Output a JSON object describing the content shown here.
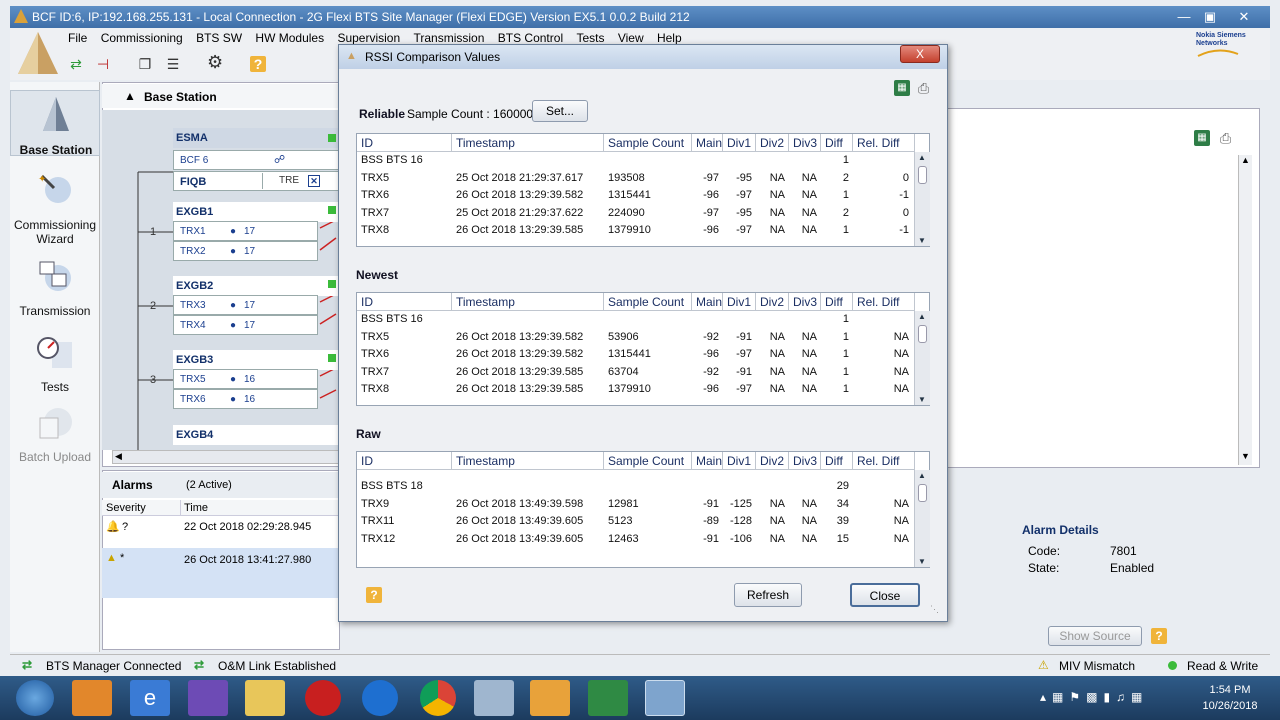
{
  "window": {
    "title": "BCF ID:6,  IP:192.168.255.131 - Local Connection - 2G Flexi BTS Site Manager (Flexi EDGE) Version EX5.1 0.0.2 Build 212"
  },
  "menu": [
    "File",
    "Commissioning",
    "BTS SW",
    "HW Modules",
    "Supervision",
    "Transmission",
    "BTS Control",
    "Tests",
    "View",
    "Help"
  ],
  "brand": {
    "line1": "Nokia Siemens",
    "line2": "Networks"
  },
  "nav": [
    {
      "label": "Base Station"
    },
    {
      "label": "Commissioning Wizard"
    },
    {
      "label": "Transmission"
    },
    {
      "label": "Tests"
    },
    {
      "label": "Batch Upload"
    }
  ],
  "base_station": {
    "header": "Base Station",
    "esma": "ESMA",
    "bcf": "BCF 6",
    "fiqb": "FIQB",
    "tre": "TRE",
    "groups": [
      {
        "name": "EXGB1",
        "num": "1",
        "trx": [
          {
            "name": "TRX1",
            "val": "17"
          },
          {
            "name": "TRX2",
            "val": "17"
          }
        ]
      },
      {
        "name": "EXGB2",
        "num": "2",
        "trx": [
          {
            "name": "TRX3",
            "val": "17"
          },
          {
            "name": "TRX4",
            "val": "17"
          }
        ]
      },
      {
        "name": "EXGB3",
        "num": "3",
        "trx": [
          {
            "name": "TRX5",
            "val": "16"
          },
          {
            "name": "TRX6",
            "val": "16"
          }
        ]
      },
      {
        "name": "EXGB4"
      }
    ]
  },
  "alarms": {
    "title": "Alarms",
    "active": "(2 Active)",
    "col_severity": "Severity",
    "col_time": "Time",
    "rows": [
      {
        "sev": "?",
        "time": "22 Oct 2018 02:29:28.945"
      },
      {
        "sev": "*",
        "time": "26 Oct 2018 13:41:27.980"
      }
    ]
  },
  "alarm_details": {
    "title": "Alarm Details",
    "code_label": "Code:",
    "code": "7801",
    "state_label": "State:",
    "state": "Enabled",
    "show_source": "Show Source"
  },
  "dialog": {
    "title": "RSSI Comparison Values",
    "close_x": "X",
    "reliable_label": "Reliable",
    "sample_count_label": "Sample Count : 160000",
    "set_button": "Set...",
    "newest_label": "Newest",
    "raw_label": "Raw",
    "refresh_button": "Refresh",
    "close_button": "Close",
    "columns": [
      "ID",
      "Timestamp",
      "Sample Count",
      "Main",
      "Div1",
      "Div2",
      "Div3",
      "Diff",
      "Rel. Diff"
    ],
    "reliable_rows": [
      [
        "BSS BTS 16",
        "",
        "",
        "",
        "",
        "",
        "",
        "1",
        ""
      ],
      [
        "TRX5",
        "25 Oct 2018 21:29:37.617",
        "193508",
        "-97",
        "-95",
        "NA",
        "NA",
        "2",
        "0"
      ],
      [
        "TRX6",
        "26 Oct 2018 13:29:39.582",
        "1315441",
        "-96",
        "-97",
        "NA",
        "NA",
        "1",
        "-1"
      ],
      [
        "TRX7",
        "25 Oct 2018 21:29:37.622",
        "224090",
        "-97",
        "-95",
        "NA",
        "NA",
        "2",
        "0"
      ],
      [
        "TRX8",
        "26 Oct 2018 13:29:39.585",
        "1379910",
        "-96",
        "-97",
        "NA",
        "NA",
        "1",
        "-1"
      ]
    ],
    "newest_rows": [
      [
        "BSS BTS 16",
        "",
        "",
        "",
        "",
        "",
        "",
        "1",
        ""
      ],
      [
        "TRX5",
        "26 Oct 2018 13:29:39.582",
        "53906",
        "-92",
        "-91",
        "NA",
        "NA",
        "1",
        "NA"
      ],
      [
        "TRX6",
        "26 Oct 2018 13:29:39.582",
        "1315441",
        "-96",
        "-97",
        "NA",
        "NA",
        "1",
        "NA"
      ],
      [
        "TRX7",
        "26 Oct 2018 13:29:39.585",
        "63704",
        "-92",
        "-91",
        "NA",
        "NA",
        "1",
        "NA"
      ],
      [
        "TRX8",
        "26 Oct 2018 13:29:39.585",
        "1379910",
        "-96",
        "-97",
        "NA",
        "NA",
        "1",
        "NA"
      ]
    ],
    "raw_rows": [
      [
        "BSS BTS 18",
        "",
        "",
        "",
        "",
        "",
        "",
        "29",
        ""
      ],
      [
        "TRX9",
        "26 Oct 2018 13:49:39.598",
        "12981",
        "-91",
        "-125",
        "NA",
        "NA",
        "34",
        "NA"
      ],
      [
        "TRX11",
        "26 Oct 2018 13:49:39.605",
        "5123",
        "-89",
        "-128",
        "NA",
        "NA",
        "39",
        "NA"
      ],
      [
        "TRX12",
        "26 Oct 2018 13:49:39.605",
        "12463",
        "-91",
        "-106",
        "NA",
        "NA",
        "15",
        "NA"
      ]
    ]
  },
  "status": {
    "bts_connected": "BTS Manager Connected",
    "om_link": "O&M Link Established",
    "mismatch": "MIV Mismatch",
    "rw": "Read & Write"
  },
  "clock": {
    "time": "1:54 PM",
    "date": "10/26/2018"
  },
  "colors": {
    "titlebar": "#4a7db8",
    "taskbar": "#234a72",
    "link_green": "#2e9b3a",
    "dialog_bg": "#eef0f3"
  }
}
